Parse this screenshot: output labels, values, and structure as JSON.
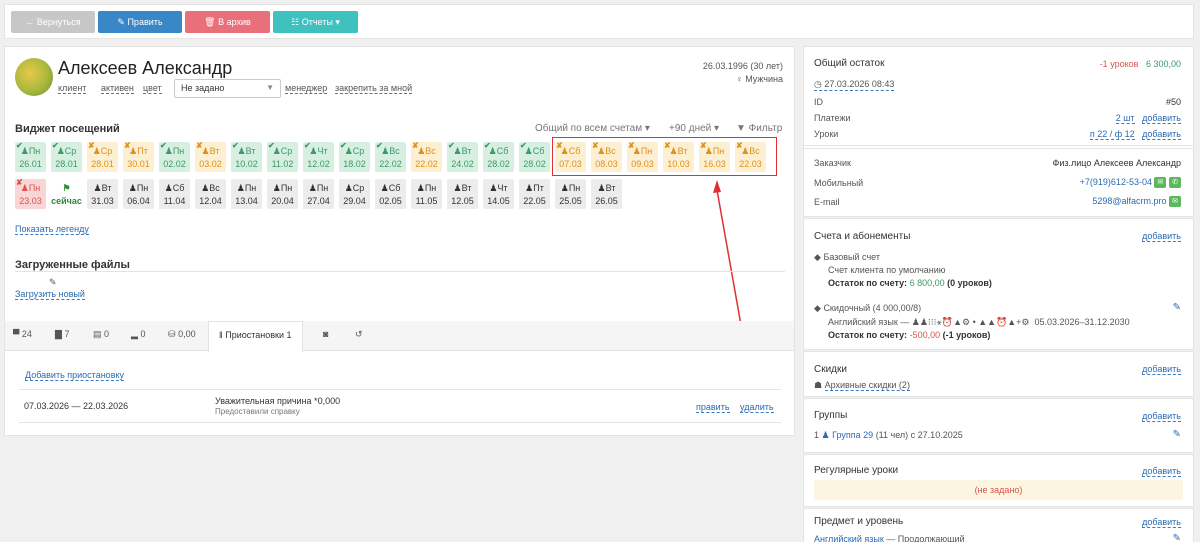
{
  "toolbar": {
    "back": "← Вернуться",
    "edit": "✎ Править",
    "archive": "🗑 В архив",
    "reports": "☷ Отчеты ▾",
    "back_color": "#c7c7c7",
    "edit_color": "#3a87c8",
    "archive_color": "#e9707a",
    "reports_color": "#3fc1c0"
  },
  "client": {
    "name": "Алексеев Александр",
    "type": "клиент",
    "status": "активен",
    "color": "цвет",
    "manager_select": "Не задано",
    "manager": "менеджер",
    "assign": "закрепить за мной",
    "dob": "26.03.1996 (30 лет)",
    "gender": "♀ Мужчина"
  },
  "widget": {
    "title": "Виджет посещений",
    "scope": "Общий по всем счетам ▾",
    "range": "+90 дней ▾",
    "filter": "▼ Фильтр",
    "legend": "Показать легенду"
  },
  "days_row1": [
    {
      "label": "Пн",
      "date": "26.01",
      "style": "g",
      "mark": "✔"
    },
    {
      "label": "Ср",
      "date": "28.01",
      "style": "g",
      "mark": "✔"
    },
    {
      "label": "Ср",
      "date": "28.01",
      "style": "o",
      "mark": "✘"
    },
    {
      "label": "Пт",
      "date": "30.01",
      "style": "o",
      "mark": "✘"
    },
    {
      "label": "Пн",
      "date": "02.02",
      "style": "g",
      "mark": "✔"
    },
    {
      "label": "Вт",
      "date": "03.02",
      "style": "o",
      "mark": "✘"
    },
    {
      "label": "Вт",
      "date": "10.02",
      "style": "g",
      "mark": "✔"
    },
    {
      "label": "Ср",
      "date": "11.02",
      "style": "g",
      "mark": "✔"
    },
    {
      "label": "Чт",
      "date": "12.02",
      "style": "g",
      "mark": "✔"
    },
    {
      "label": "Ср",
      "date": "18.02",
      "style": "g",
      "mark": "✔"
    },
    {
      "label": "Вс",
      "date": "22.02",
      "style": "g",
      "mark": "✔"
    },
    {
      "label": "Вс",
      "date": "22.02",
      "style": "o",
      "mark": "✘"
    },
    {
      "label": "Вт",
      "date": "24.02",
      "style": "g",
      "mark": "✔"
    },
    {
      "label": "Сб",
      "date": "28.02",
      "style": "g",
      "mark": "✔"
    },
    {
      "label": "Сб",
      "date": "28.02",
      "style": "g",
      "mark": "✔"
    },
    {
      "label": "Сб",
      "date": "07.03",
      "style": "o",
      "mark": "✘"
    },
    {
      "label": "Вс",
      "date": "08.03",
      "style": "o",
      "mark": "✘"
    },
    {
      "label": "Пн",
      "date": "09.03",
      "style": "o",
      "mark": "✘"
    },
    {
      "label": "Вт",
      "date": "10.03",
      "style": "o",
      "mark": "✘"
    },
    {
      "label": "Пн",
      "date": "16.03",
      "style": "o",
      "mark": "✘"
    },
    {
      "label": "Вс",
      "date": "22.03",
      "style": "o",
      "mark": "✘"
    }
  ],
  "days_row2": [
    {
      "label": "Пн",
      "date": "23.03",
      "style": "r",
      "mark": "✘"
    },
    {
      "label": "⚑",
      "date": "сейчас",
      "style": "nw",
      "mark": ""
    },
    {
      "label": "Вт",
      "date": "31.03",
      "style": "gr",
      "mark": ""
    },
    {
      "label": "Пн",
      "date": "06.04",
      "style": "gr",
      "mark": ""
    },
    {
      "label": "Сб",
      "date": "11.04",
      "style": "gr",
      "mark": ""
    },
    {
      "label": "Вс",
      "date": "12.04",
      "style": "gr",
      "mark": ""
    },
    {
      "label": "Пн",
      "date": "13.04",
      "style": "gr",
      "mark": ""
    },
    {
      "label": "Пн",
      "date": "20.04",
      "style": "gr",
      "mark": ""
    },
    {
      "label": "Пн",
      "date": "27.04",
      "style": "gr",
      "mark": ""
    },
    {
      "label": "Ср",
      "date": "29.04",
      "style": "gr",
      "mark": ""
    },
    {
      "label": "Сб",
      "date": "02.05",
      "style": "gr",
      "mark": ""
    },
    {
      "label": "Пн",
      "date": "11.05",
      "style": "gr",
      "mark": ""
    },
    {
      "label": "Вт",
      "date": "12.05",
      "style": "gr",
      "mark": ""
    },
    {
      "label": "Чт",
      "date": "14.05",
      "style": "gr",
      "mark": ""
    },
    {
      "label": "Пт",
      "date": "22.05",
      "style": "gr",
      "mark": ""
    },
    {
      "label": "Пн",
      "date": "25.05",
      "style": "gr",
      "mark": ""
    },
    {
      "label": "Вт",
      "date": "26.05",
      "style": "gr",
      "mark": ""
    }
  ],
  "files": {
    "title": "Загруженные файлы",
    "upload": "Загрузить новый"
  },
  "tabs": [
    {
      "label": "24",
      "icon": "comment-icon"
    },
    {
      "label": "7",
      "icon": "chat-icon"
    },
    {
      "label": "0",
      "icon": "file-icon"
    },
    {
      "label": "0",
      "icon": "chart-icon"
    },
    {
      "label": "0,00",
      "icon": "money-icon"
    },
    {
      "label": "Приостановки 1",
      "icon": "pause-icon"
    },
    {
      "label": "◙",
      "icon": "camera-icon"
    },
    {
      "label": "↺",
      "icon": "history-icon"
    }
  ],
  "pauses": {
    "add": "Добавить приостановку",
    "period": "07.03.2026 — 22.03.2026",
    "reason": "Уважительная причина *0,000",
    "note": "Предоставили справку",
    "edit": "править",
    "delete": "удалить"
  },
  "balance": {
    "title": "Общий остаток",
    "lessons": "-1 уроков",
    "amount": "6 300,00",
    "date": "27.03.2026 08:43",
    "id_label": "ID",
    "id": "#50",
    "payments_label": "Платежи",
    "payments": "2 шт",
    "add": "добавить",
    "lessons_label": "Уроки",
    "lessons_val": "п 22 / ф 12"
  },
  "contact": {
    "customer_label": "Заказчик",
    "customer": "Физ.лицо Алексеев Александр",
    "mobile_label": "Мобильный",
    "mobile": "+7(919)612-53-04",
    "email_label": "E-mail",
    "email": "5298@alfacrm.pro"
  },
  "accounts": {
    "title": "Счета и абонементы",
    "add": "добавить",
    "base": "Базовый счет",
    "base_desc": "Счет клиента по умолчанию",
    "base_bal_label": "Остаток по счету:",
    "base_bal": "6 800,00",
    "base_bal_tail": "(0 уроков)",
    "disc": "Скидочный (4 000,00/8)",
    "disc_desc": "Английский язык — ♟♟⁝⁝⁝⚹⏰▲⚙ • ▲▲⏰▲+⚙",
    "disc_period": "05.03.2026–31.12.2030",
    "disc_bal_label": "Остаток по счету:",
    "disc_bal": "-500,00",
    "disc_bal_tail": "(-1 уроков)"
  },
  "discounts": {
    "title": "Скидки",
    "add": "добавить",
    "archive": "Архивные скидки (2)"
  },
  "groups": {
    "title": "Группы",
    "add": "добавить",
    "item_num": "1",
    "item": "Группа 29",
    "item_tail": "(11 чел) с 27.10.2025"
  },
  "regular": {
    "title": "Регулярные уроки",
    "add": "добавить",
    "empty": "(не задано)"
  },
  "subject": {
    "title": "Предмет и уровень",
    "add": "добавить",
    "item": "Английский язык",
    "item_tail": "— Продолжающий"
  }
}
